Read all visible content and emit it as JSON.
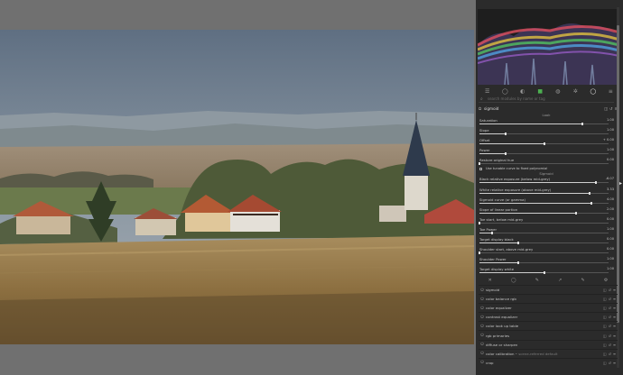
{
  "search": {
    "placeholder": "search modules by name or tag"
  },
  "module_groups": [
    {
      "icon": "sliders-icon"
    },
    {
      "icon": "circle-icon"
    },
    {
      "icon": "circle-half-icon"
    },
    {
      "icon": "color-square-icon"
    },
    {
      "icon": "drop-icon"
    },
    {
      "icon": "aperture-icon"
    },
    {
      "icon": "circle-outline-icon"
    },
    {
      "icon": "menu-icon"
    }
  ],
  "active_module": {
    "name": "sigmoid"
  },
  "sections": {
    "look": "Look",
    "sigmoid": "Sigmoid"
  },
  "look_sliders": [
    {
      "label": "Saturation",
      "value": "1.00",
      "fraction": 0.8
    },
    {
      "label": "Slope",
      "value": "1.00",
      "fraction": 0.2
    },
    {
      "label": "Offset",
      "value": "+ 0.00",
      "fraction": 0.5
    },
    {
      "label": "Power",
      "value": "1.00",
      "fraction": 0.2
    },
    {
      "label": "Restore original hue",
      "value": "0.00",
      "fraction": 0.0
    }
  ],
  "checkbox": {
    "label": "Use tunable curve to fixed polynomial"
  },
  "sigmoid_sliders": [
    {
      "label": "Black relative exposure (below mid-grey)",
      "value": "-6.07",
      "fraction": 0.9
    },
    {
      "label": "White relative exposure (above mid-grey)",
      "value": "3.33",
      "fraction": 0.85
    },
    {
      "label": "Sigmoid curve (or gamma)",
      "value": "4.00",
      "fraction": 0.87
    },
    {
      "label": "Slope of linear portion",
      "value": "2.00",
      "fraction": 0.75
    },
    {
      "label": "Toe start, below mid-grey",
      "value": "0.00",
      "fraction": 0.0
    },
    {
      "label": "Toe Power",
      "value": "1.00",
      "fraction": 0.1
    },
    {
      "label": "Target display black",
      "value": "0.00",
      "fraction": 0.3
    },
    {
      "label": "Shoulder start, above mid-grey",
      "value": "0.00",
      "fraction": 0.0
    },
    {
      "label": "Shoulder Power",
      "value": "1.00",
      "fraction": 0.3
    },
    {
      "label": "Target display white",
      "value": "1.00",
      "fraction": 0.5
    }
  ],
  "modules": [
    {
      "name": "sigmoid",
      "sub": ""
    },
    {
      "name": "color balance rgb",
      "sub": ""
    },
    {
      "name": "color equalizer",
      "sub": ""
    },
    {
      "name": "contrast equalizer",
      "sub": ""
    },
    {
      "name": "color look up table",
      "sub": ""
    },
    {
      "name": "rgb primaries",
      "sub": ""
    },
    {
      "name": "diffuse or sharpen",
      "sub": ""
    },
    {
      "name": "color calibration",
      "sub": "• scene-referred default"
    },
    {
      "name": "crop",
      "sub": ""
    }
  ]
}
